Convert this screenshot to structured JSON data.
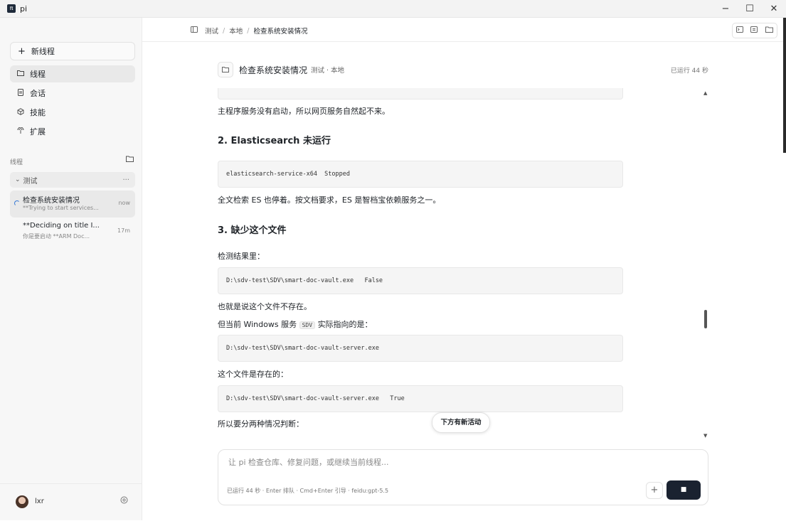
{
  "window": {
    "app_name": "pi",
    "app_glyph": "π",
    "minimize": "−",
    "maximize": "☐",
    "close": "✕"
  },
  "sidebar": {
    "new_thread": "新线程",
    "nav": [
      {
        "label": "线程",
        "icon": "folder-icon"
      },
      {
        "label": "会话",
        "icon": "document-icon"
      },
      {
        "label": "技能",
        "icon": "cube-icon"
      },
      {
        "label": "扩展",
        "icon": "plug-icon"
      }
    ],
    "section_label": "线程",
    "group": {
      "name": "测试",
      "more": "..."
    },
    "threads": [
      {
        "title": "检查系统安装情况",
        "subtitle": "**Trying to start services...",
        "time": "now"
      },
      {
        "title": "**Deciding on title I...",
        "subtitle": "你是要启动 **ARM Doc...",
        "time": "17m"
      }
    ],
    "user": {
      "name": "lxr"
    }
  },
  "breadcrumb": {
    "items": [
      "测试",
      "本地",
      "检查系统安装情况"
    ]
  },
  "thread_header": {
    "title": "检查系统安装情况",
    "meta": "测试 · 本地",
    "runtime": "已运行 44 秒"
  },
  "content": {
    "p1": "主程序服务没有启动，所以网页服务自然起不来。",
    "h2": "2. Elasticsearch 未运行",
    "code1": "elasticsearch-service-x64  Stopped",
    "p2": "全文检索 ES 也停着。按文档要求，ES 是智档宝依赖服务之一。",
    "h3": "3. 缺少这个文件",
    "p3": "检测结果里：",
    "code2": "D:\\sdv-test\\SDV\\smart-doc-vault.exe   False",
    "p4": "也就是说这个文件不存在。",
    "p5_pre": "但当前 Windows 服务",
    "p5_code": "SDV",
    "p5_post": "实际指向的是：",
    "code3": "D:\\sdv-test\\SDV\\smart-doc-vault-server.exe",
    "p6": "这个文件是存在的：",
    "code4": "D:\\sdv-test\\SDV\\smart-doc-vault-server.exe   True",
    "p7": "所以要分两种情况判断："
  },
  "new_activity": "下方有新活动",
  "composer": {
    "placeholder": "让 pi 检查仓库、修复问题，或继续当前线程...",
    "hint": "已运行 44 秒 · Enter 排队 · Cmd+Enter 引导 · feidu:gpt-5.5",
    "add": "+",
    "stop": "■"
  }
}
